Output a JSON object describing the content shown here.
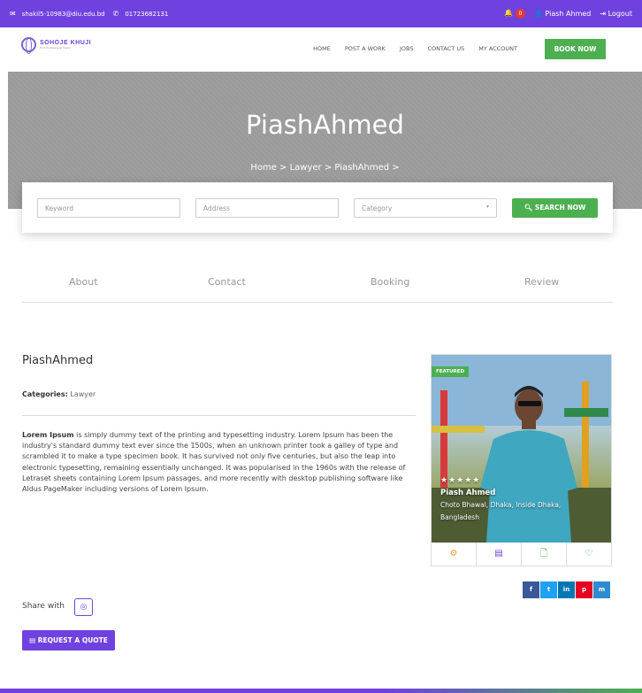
{
  "topbar": {
    "email": "shakil5-10983@diu.edu.bd",
    "phone": "01723682131",
    "notification_count": "0",
    "user_name": "Piash Ahmed",
    "logout_label": "Logout"
  },
  "brand": {
    "name": "SOHOJE KHUJI",
    "tagline": "Find Professional Easily"
  },
  "menu": {
    "items": [
      "HOME",
      "POST A WORK",
      "JOBS",
      "CONTACT US",
      "MY ACCOUNT"
    ],
    "book_now": "BOOK NOW"
  },
  "hero": {
    "title": "PiashAhmed",
    "breadcrumb": "Home > Lawyer > PiashAhmed >"
  },
  "search": {
    "keyword_placeholder": "Keyword",
    "address_placeholder": "Address",
    "category_placeholder": "Category",
    "button": "SEARCH NOW"
  },
  "tabs": [
    "About",
    "Contact",
    "Booking",
    "Review"
  ],
  "profile": {
    "name": "PiashAhmed",
    "categories_label": "Categories:",
    "category": "Lawyer",
    "desc_lead": "Lorem Ipsum",
    "desc_rest": " is simply dummy text of the printing and typesetting industry. Lorem Ipsum has been the industry's standard dummy text ever since the 1500s, when an unknown printer took a galley of type and scrambled it to make a type specimen book. It has survived not only five centuries, but also the leap into electronic typesetting, remaining essentially unchanged. It was popularised in the 1960s with the release of Letraset sheets containing Lorem Ipsum passages, and more recently with desktop publishing software like Aldus PageMaker including versions of Lorem Ipsum."
  },
  "card": {
    "badge": "FEATURED",
    "stars": "★★★★★",
    "name": "Piash Ahmed",
    "location": "Choto Bhawal, Dhaka, Inside Dhaka, Bangladesh",
    "icons": [
      "gear-icon",
      "chat-icon",
      "document-icon",
      "heart-icon"
    ]
  },
  "social": [
    "f",
    "t",
    "in",
    "p",
    "m"
  ],
  "share_label": "Share with",
  "quote_button": "REQUEST A QUOTE",
  "colors": {
    "primary": "#6f42e0",
    "accent": "#4caf50"
  }
}
